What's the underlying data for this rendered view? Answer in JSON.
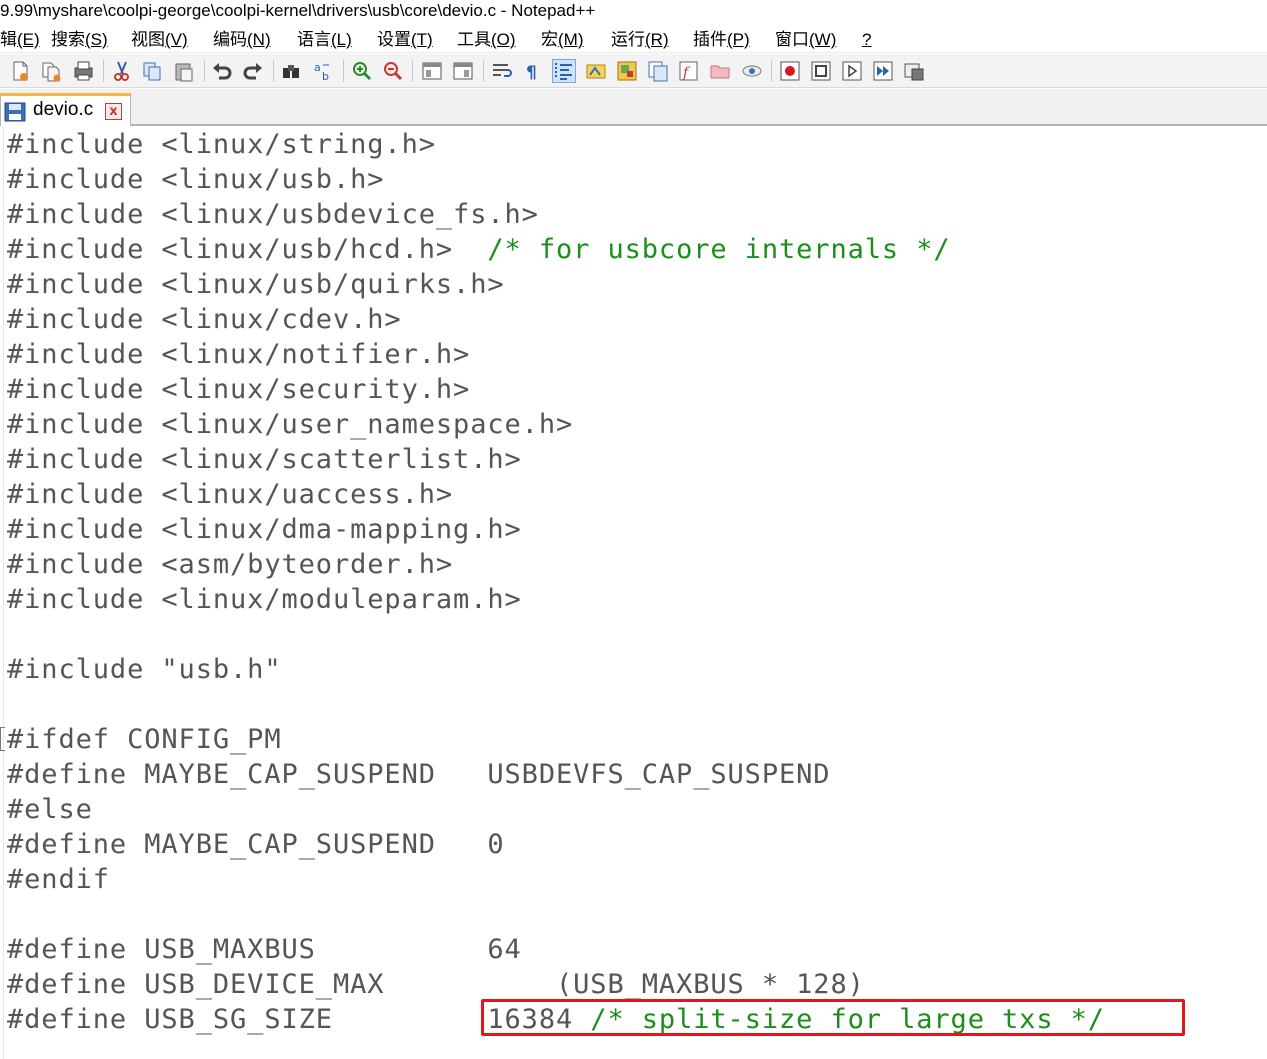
{
  "window": {
    "title": "9.99\\myshare\\coolpi-george\\coolpi-kernel\\drivers\\usb\\core\\devio.c - Notepad++"
  },
  "menu": {
    "items": [
      {
        "label": "辑",
        "key": "(E)"
      },
      {
        "label": "搜索",
        "key": "(S)"
      },
      {
        "label": "视图",
        "key": "(V)"
      },
      {
        "label": "编码",
        "key": "(N)"
      },
      {
        "label": "语言",
        "key": "(L)"
      },
      {
        "label": "设置",
        "key": "(T)"
      },
      {
        "label": "工具",
        "key": "(O)"
      },
      {
        "label": "宏",
        "key": "(M)"
      },
      {
        "label": "运行",
        "key": "(R)"
      },
      {
        "label": "插件",
        "key": "(P)"
      },
      {
        "label": "窗口",
        "key": "(W)"
      },
      {
        "label": "",
        "key": "?"
      }
    ]
  },
  "toolbar": {
    "icons": [
      "new-file-icon",
      "open-file-icon",
      "save-all-icon",
      "print-icon",
      "cut-icon",
      "copy-icon",
      "paste-icon",
      "undo-icon",
      "redo-icon",
      "find-icon",
      "replace-icon",
      "zoom-in-icon",
      "zoom-out-icon",
      "sync-vertical-icon",
      "sync-horizontal-icon",
      "word-wrap-icon",
      "show-all-chars-icon",
      "indent-guide-icon",
      "user-lang-icon",
      "doc-map-icon",
      "doc-list-icon",
      "function-list-icon",
      "folder-workspace-icon",
      "monitoring-icon",
      "record-macro-icon",
      "stop-record-icon",
      "play-macro-icon",
      "run-multiple-macro-icon",
      "save-macro-icon"
    ]
  },
  "tab": {
    "label": "devio.c",
    "close_symbol": "x"
  },
  "editor": {
    "lines": [
      {
        "code": "#include <linux/string.h>",
        "comment": ""
      },
      {
        "code": "#include <linux/usb.h>",
        "comment": ""
      },
      {
        "code": "#include <linux/usbdevice_fs.h>",
        "comment": ""
      },
      {
        "code": "#include <linux/usb/hcd.h>  ",
        "comment": "/* for usbcore internals */"
      },
      {
        "code": "#include <linux/usb/quirks.h>",
        "comment": ""
      },
      {
        "code": "#include <linux/cdev.h>",
        "comment": ""
      },
      {
        "code": "#include <linux/notifier.h>",
        "comment": ""
      },
      {
        "code": "#include <linux/security.h>",
        "comment": ""
      },
      {
        "code": "#include <linux/user_namespace.h>",
        "comment": ""
      },
      {
        "code": "#include <linux/scatterlist.h>",
        "comment": ""
      },
      {
        "code": "#include <linux/uaccess.h>",
        "comment": ""
      },
      {
        "code": "#include <linux/dma-mapping.h>",
        "comment": ""
      },
      {
        "code": "#include <asm/byteorder.h>",
        "comment": ""
      },
      {
        "code": "#include <linux/moduleparam.h>",
        "comment": ""
      },
      {
        "code": "",
        "comment": ""
      },
      {
        "code": "#include \"usb.h\"",
        "comment": ""
      },
      {
        "code": "",
        "comment": ""
      },
      {
        "code": "#ifdef CONFIG_PM",
        "comment": ""
      },
      {
        "code": "#define MAYBE_CAP_SUSPEND   USBDEVFS_CAP_SUSPEND",
        "comment": ""
      },
      {
        "code": "#else",
        "comment": ""
      },
      {
        "code": "#define MAYBE_CAP_SUSPEND   0",
        "comment": ""
      },
      {
        "code": "#endif",
        "comment": ""
      },
      {
        "code": "",
        "comment": ""
      },
      {
        "code": "#define USB_MAXBUS          64",
        "comment": ""
      },
      {
        "code": "#define USB_DEVICE_MAX          (USB_MAXBUS * 128)",
        "comment": ""
      },
      {
        "code": "#define USB_SG_SIZE         16384 ",
        "comment": "/* split-size for large txs */"
      }
    ]
  }
}
